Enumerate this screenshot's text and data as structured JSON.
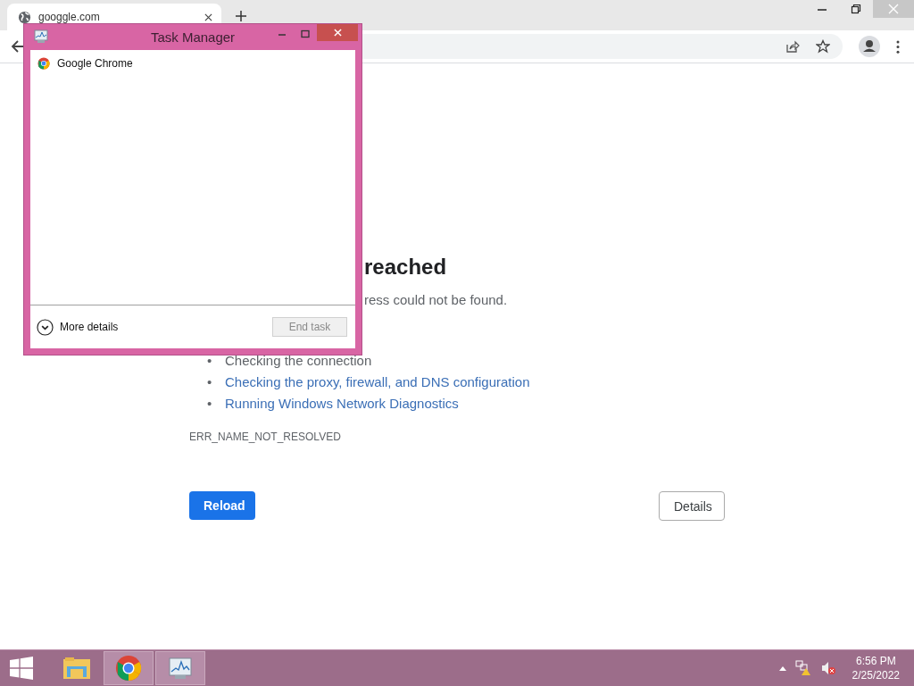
{
  "browser": {
    "tabs": [
      {
        "title": "googgle.com",
        "selected": true
      }
    ],
    "error_page": {
      "heading": "reached",
      "message": "ress could not be found.",
      "suggestions": [
        {
          "bullet": "•",
          "text": "Checking the connection",
          "kind": "plain"
        },
        {
          "bullet": "•",
          "text": "Checking the proxy, firewall, and DNS configuration",
          "kind": "link"
        },
        {
          "bullet": "•",
          "text": "Running Windows Network Diagnostics",
          "kind": "link"
        }
      ],
      "error_code": "ERR_NAME_NOT_RESOLVED",
      "buttons": [
        {
          "label": "Reload",
          "kind": "primary"
        },
        {
          "label": "Details",
          "kind": "secondary"
        }
      ]
    }
  },
  "task_manager": {
    "title": "Task Manager",
    "processes": [
      {
        "name": "Google Chrome"
      }
    ],
    "more_details": "More details",
    "end_task": {
      "label": "End task",
      "disabled": true
    }
  },
  "taskbar": {
    "items": [
      {
        "kind": "explorer",
        "running": false
      },
      {
        "kind": "chrome",
        "running": true
      },
      {
        "kind": "taskmgr",
        "running": true
      }
    ],
    "clock": {
      "time": "6:56 PM",
      "date": "2/25/2022"
    }
  }
}
